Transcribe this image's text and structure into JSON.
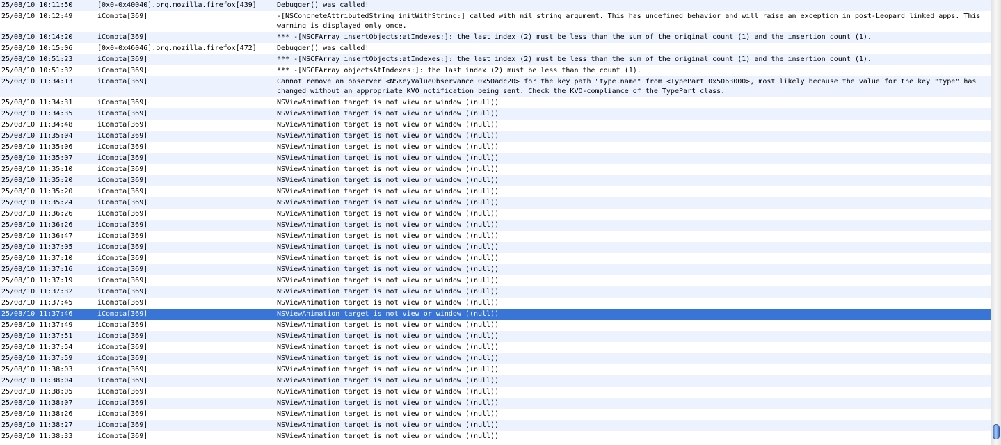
{
  "log": {
    "selected_index": 26,
    "entries": [
      {
        "time": "25/08/10 10:11:50",
        "sender": "[0x0-0x40040].org.mozilla.firefox[439]",
        "message": "Debugger() was called!"
      },
      {
        "time": "25/08/10 10:12:49",
        "sender": "iCompta[369]",
        "message": "-[NSConcreteAttributedString initWithString:] called with nil string argument. This has undefined behavior and will raise an exception in post-Leopard linked apps. This warning is displayed only once."
      },
      {
        "time": "25/08/10 10:14:20",
        "sender": "iCompta[369]",
        "message": "*** -[NSCFArray insertObjects:atIndexes:]: the last index (2) must be less than the sum of the original count (1) and the insertion count (1)."
      },
      {
        "time": "25/08/10 10:15:06",
        "sender": "[0x0-0x46046].org.mozilla.firefox[472]",
        "message": "Debugger() was called!"
      },
      {
        "time": "25/08/10 10:51:23",
        "sender": "iCompta[369]",
        "message": "*** -[NSCFArray insertObjects:atIndexes:]: the last index (2) must be less than the sum of the original count (1) and the insertion count (1)."
      },
      {
        "time": "25/08/10 10:51:32",
        "sender": "iCompta[369]",
        "message": "*** -[NSCFArray objectsAtIndexes:]: the last index (2) must be less than the count (1)."
      },
      {
        "time": "25/08/10 11:34:13",
        "sender": "iCompta[369]",
        "message": "Cannot remove an observer <NSKeyValueObservance 0x50adc20> for the key path \"type.name\" from <TypePart 0x5063000>, most likely because the value for the key \"type\" has changed without an appropriate KVO notification being sent. Check the KVO-compliance of the TypePart class."
      },
      {
        "time": "25/08/10 11:34:31",
        "sender": "iCompta[369]",
        "message": "NSViewAnimation target is not view or window ((null))"
      },
      {
        "time": "25/08/10 11:34:35",
        "sender": "iCompta[369]",
        "message": "NSViewAnimation target is not view or window ((null))"
      },
      {
        "time": "25/08/10 11:34:48",
        "sender": "iCompta[369]",
        "message": "NSViewAnimation target is not view or window ((null))"
      },
      {
        "time": "25/08/10 11:35:04",
        "sender": "iCompta[369]",
        "message": "NSViewAnimation target is not view or window ((null))"
      },
      {
        "time": "25/08/10 11:35:06",
        "sender": "iCompta[369]",
        "message": "NSViewAnimation target is not view or window ((null))"
      },
      {
        "time": "25/08/10 11:35:07",
        "sender": "iCompta[369]",
        "message": "NSViewAnimation target is not view or window ((null))"
      },
      {
        "time": "25/08/10 11:35:10",
        "sender": "iCompta[369]",
        "message": "NSViewAnimation target is not view or window ((null))"
      },
      {
        "time": "25/08/10 11:35:20",
        "sender": "iCompta[369]",
        "message": "NSViewAnimation target is not view or window ((null))"
      },
      {
        "time": "25/08/10 11:35:20",
        "sender": "iCompta[369]",
        "message": "NSViewAnimation target is not view or window ((null))"
      },
      {
        "time": "25/08/10 11:35:24",
        "sender": "iCompta[369]",
        "message": "NSViewAnimation target is not view or window ((null))"
      },
      {
        "time": "25/08/10 11:36:26",
        "sender": "iCompta[369]",
        "message": "NSViewAnimation target is not view or window ((null))"
      },
      {
        "time": "25/08/10 11:36:26",
        "sender": "iCompta[369]",
        "message": "NSViewAnimation target is not view or window ((null))"
      },
      {
        "time": "25/08/10 11:36:47",
        "sender": "iCompta[369]",
        "message": "NSViewAnimation target is not view or window ((null))"
      },
      {
        "time": "25/08/10 11:37:05",
        "sender": "iCompta[369]",
        "message": "NSViewAnimation target is not view or window ((null))"
      },
      {
        "time": "25/08/10 11:37:10",
        "sender": "iCompta[369]",
        "message": "NSViewAnimation target is not view or window ((null))"
      },
      {
        "time": "25/08/10 11:37:16",
        "sender": "iCompta[369]",
        "message": "NSViewAnimation target is not view or window ((null))"
      },
      {
        "time": "25/08/10 11:37:19",
        "sender": "iCompta[369]",
        "message": "NSViewAnimation target is not view or window ((null))"
      },
      {
        "time": "25/08/10 11:37:32",
        "sender": "iCompta[369]",
        "message": "NSViewAnimation target is not view or window ((null))"
      },
      {
        "time": "25/08/10 11:37:45",
        "sender": "iCompta[369]",
        "message": "NSViewAnimation target is not view or window ((null))"
      },
      {
        "time": "25/08/10 11:37:46",
        "sender": "iCompta[369]",
        "message": "NSViewAnimation target is not view or window ((null))"
      },
      {
        "time": "25/08/10 11:37:49",
        "sender": "iCompta[369]",
        "message": "NSViewAnimation target is not view or window ((null))"
      },
      {
        "time": "25/08/10 11:37:51",
        "sender": "iCompta[369]",
        "message": "NSViewAnimation target is not view or window ((null))"
      },
      {
        "time": "25/08/10 11:37:54",
        "sender": "iCompta[369]",
        "message": "NSViewAnimation target is not view or window ((null))"
      },
      {
        "time": "25/08/10 11:37:59",
        "sender": "iCompta[369]",
        "message": "NSViewAnimation target is not view or window ((null))"
      },
      {
        "time": "25/08/10 11:38:03",
        "sender": "iCompta[369]",
        "message": "NSViewAnimation target is not view or window ((null))"
      },
      {
        "time": "25/08/10 11:38:04",
        "sender": "iCompta[369]",
        "message": "NSViewAnimation target is not view or window ((null))"
      },
      {
        "time": "25/08/10 11:38:05",
        "sender": "iCompta[369]",
        "message": "NSViewAnimation target is not view or window ((null))"
      },
      {
        "time": "25/08/10 11:38:07",
        "sender": "iCompta[369]",
        "message": "NSViewAnimation target is not view or window ((null))"
      },
      {
        "time": "25/08/10 11:38:26",
        "sender": "iCompta[369]",
        "message": "NSViewAnimation target is not view or window ((null))"
      },
      {
        "time": "25/08/10 11:38:27",
        "sender": "iCompta[369]",
        "message": "NSViewAnimation target is not view or window ((null))"
      },
      {
        "time": "25/08/10 11:38:33",
        "sender": "iCompta[369]",
        "message": "NSViewAnimation target is not view or window ((null))"
      }
    ]
  },
  "colors": {
    "row_alt": "#edf3fe",
    "selection": "#3875d7",
    "scroll_thumb": "#4b7fd1"
  }
}
